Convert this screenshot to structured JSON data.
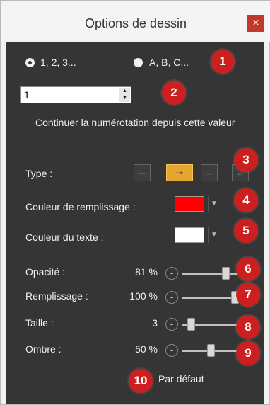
{
  "window": {
    "title": "Options de dessin",
    "close_label": "×"
  },
  "numbering": {
    "option1": "1, 2, 3...",
    "option2": "A, B, C...",
    "start_value": "1",
    "continue_label": "Continuer la numérotation depuis cette valeur"
  },
  "type": {
    "label": "Type :",
    "buttons": [
      "—",
      "⊸",
      "→",
      "↔"
    ],
    "active": 1
  },
  "fill_color": {
    "label": "Couleur de remplissage :",
    "color": "#ff0000"
  },
  "text_color": {
    "label": "Couleur du texte :",
    "color": "#ffffff"
  },
  "sliders": [
    {
      "label": "Opacité :",
      "value_text": "81 %",
      "value": 0.81
    },
    {
      "label": "Remplissage :",
      "value_text": "100 %",
      "value": 1.0
    },
    {
      "label": "Taille :",
      "value_text": "3",
      "value": 0.1
    },
    {
      "label": "Ombre :",
      "value_text": "50 %",
      "value": 0.5
    }
  ],
  "default_button": "Par défaut",
  "badges": [
    "1",
    "2",
    "3",
    "4",
    "5",
    "6",
    "7",
    "8",
    "9",
    "10"
  ],
  "colors": {
    "panel": "#353535",
    "accent": "#e6a52e",
    "badge": "#cc1f1f"
  }
}
